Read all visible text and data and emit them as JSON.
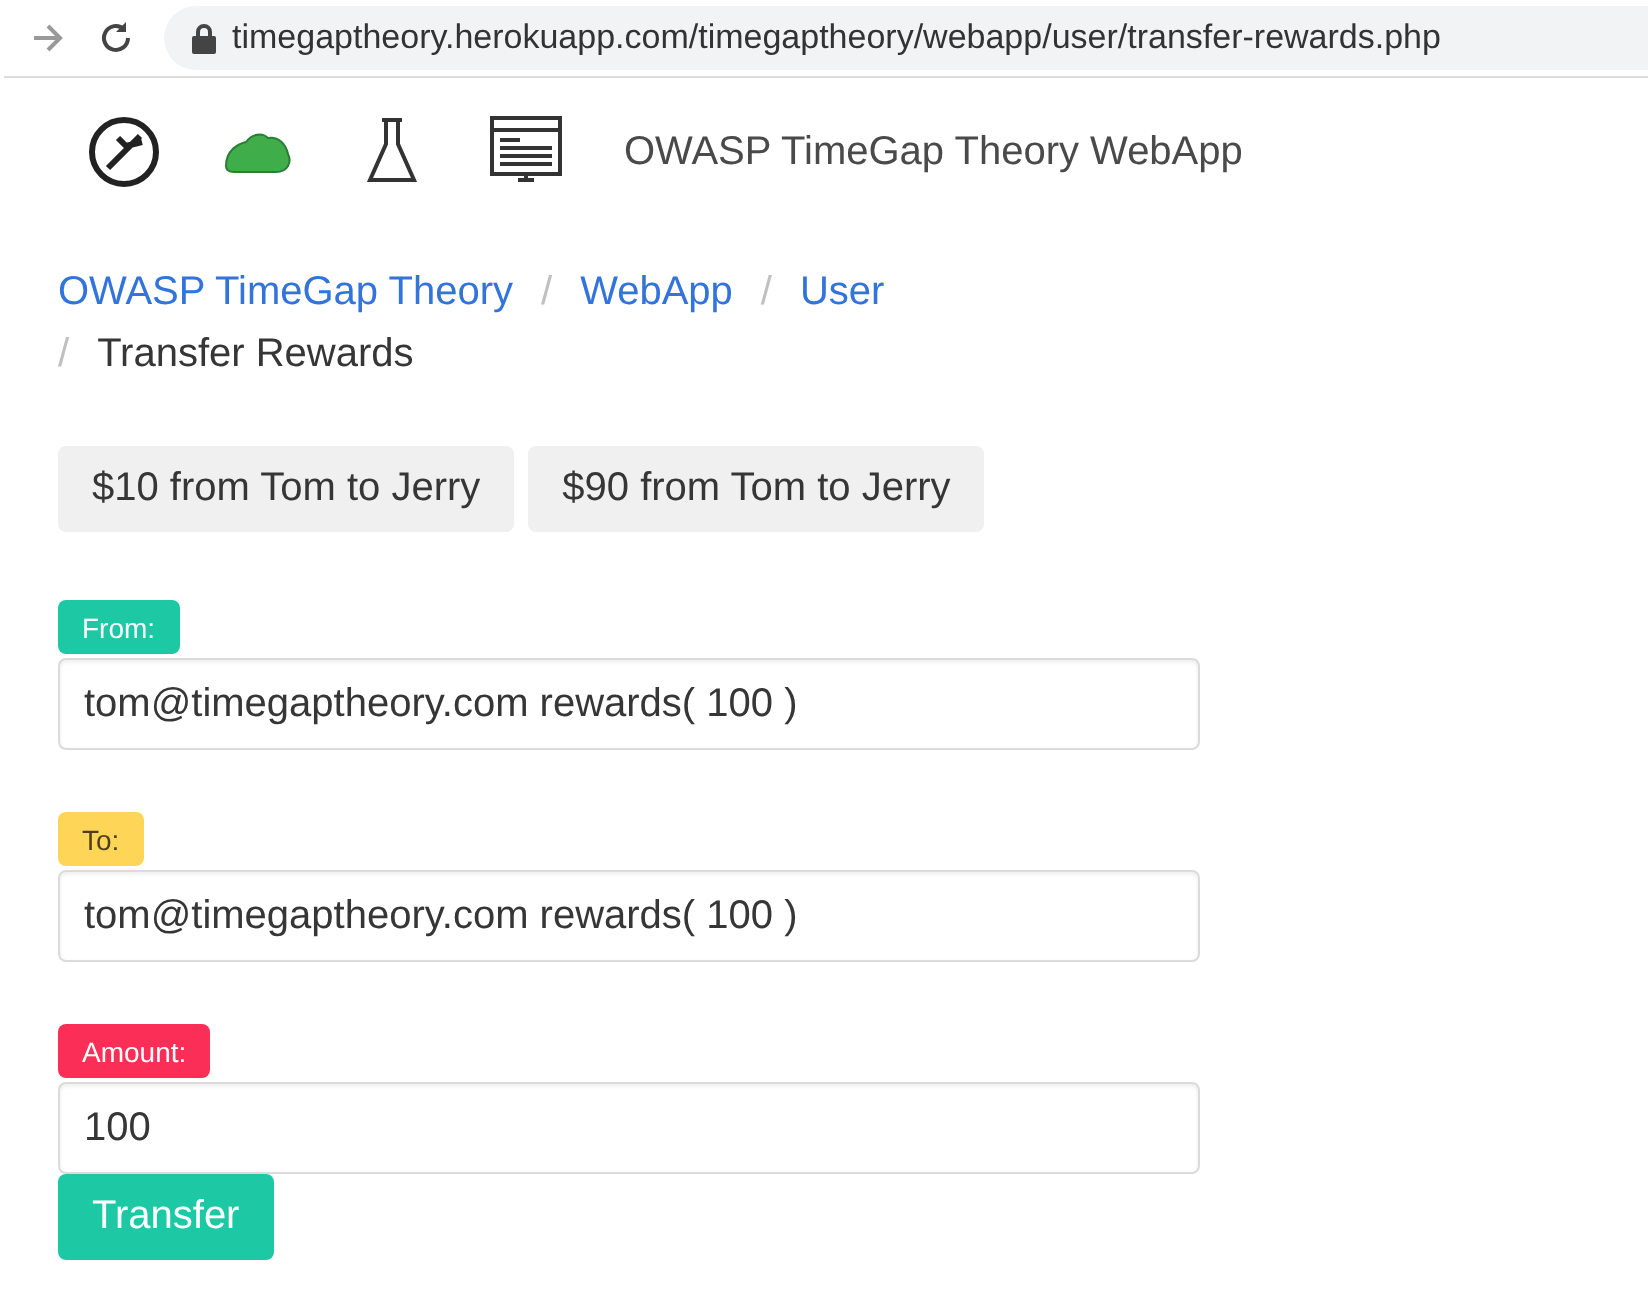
{
  "browser": {
    "url": "timegaptheory.herokuapp.com/timegaptheory/webapp/user/transfer-rewards.php"
  },
  "header": {
    "title": "OWASP TimeGap Theory WebApp"
  },
  "breadcrumb": [
    {
      "label": "OWASP TimeGap Theory",
      "selected": false
    },
    {
      "label": "WebApp",
      "selected": false
    },
    {
      "label": "User",
      "selected": false
    },
    {
      "label": "Transfer Rewards",
      "selected": true
    }
  ],
  "separator": "/",
  "presets": [
    "$10 from Tom to Jerry",
    "$90 from Tom to Jerry"
  ],
  "fields": [
    {
      "label": "From:",
      "color": "#1dc9a4",
      "value": "tom@timegaptheory.com rewards( 100 )"
    },
    {
      "label": "To:",
      "color": "#ffd558",
      "value": "tom@timegaptheory.com rewards( 100 )"
    },
    {
      "label": "Amount:",
      "color": "#fa2e57",
      "value": "100"
    }
  ],
  "submit": "Transfer"
}
